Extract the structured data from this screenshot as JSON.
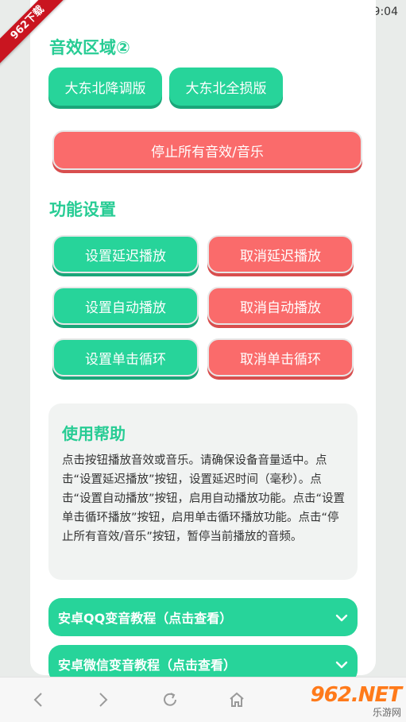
{
  "status": {
    "time": "9:04"
  },
  "watermark": {
    "ribbon": "962下载"
  },
  "sections": {
    "sound": {
      "title": "音效区域②",
      "buttons": [
        "大东北降调版",
        "大东北全损版"
      ],
      "stop_all": "停止所有音效/音乐"
    },
    "settings": {
      "title": "功能设置",
      "rows": [
        {
          "set": "设置延迟播放",
          "cancel": "取消延迟播放"
        },
        {
          "set": "设置自动播放",
          "cancel": "取消自动播放"
        },
        {
          "set": "设置单击循环",
          "cancel": "取消单击循环"
        }
      ]
    },
    "help": {
      "title": "使用帮助",
      "text": "点击按钮播放音效或音乐。请确保设备音量适中。点击“设置延迟播放”按钮，设置延迟时间（毫秒）。点击“设置自动播放”按钮，启用自动播放功能。点击“设置单击循环播放”按钮，启用单击循环播放功能。点击“停止所有音效/音乐”按钮，暂停当前播放的音频。"
    },
    "tutorials": [
      "安卓QQ变音教程（点击查看）",
      "安卓微信变音教程（点击查看）"
    ]
  },
  "brand": {
    "logo": "962.NET",
    "sub": "乐游网"
  },
  "colors": {
    "accent": "#27d49a",
    "danger": "#fa6b6b"
  }
}
